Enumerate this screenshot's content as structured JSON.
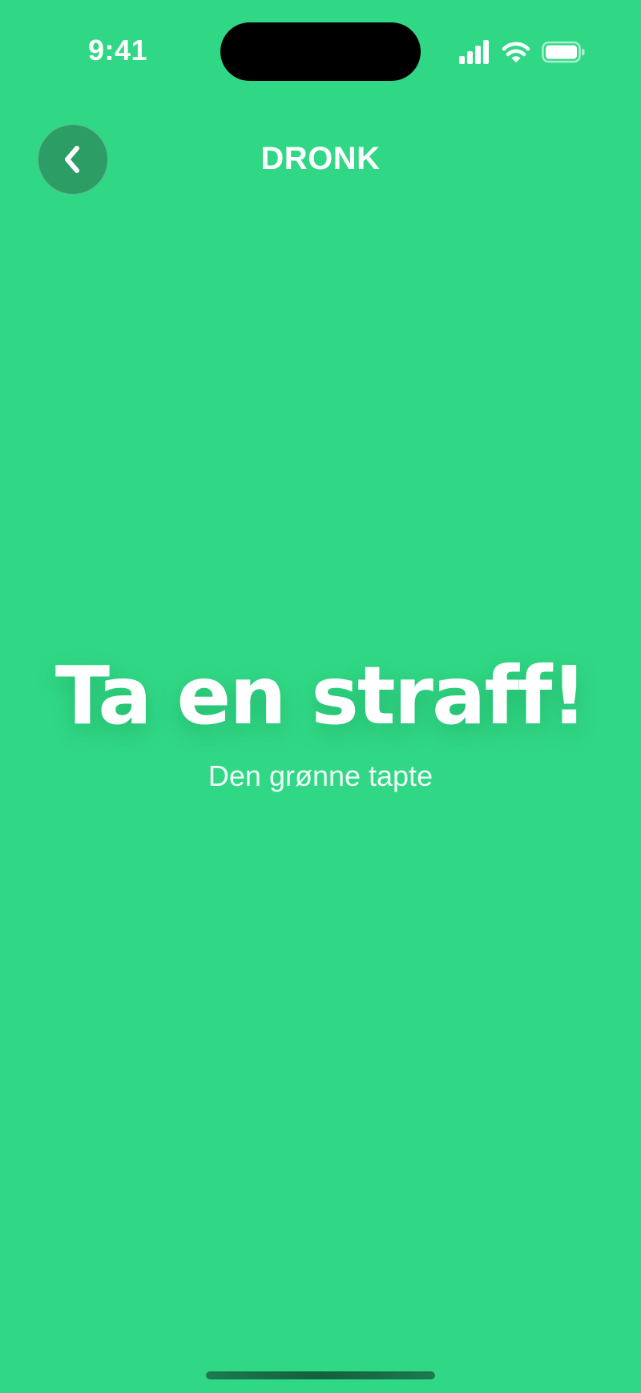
{
  "status_bar": {
    "time": "9:41",
    "icons": [
      "cellular-signal-icon",
      "wifi-icon",
      "battery-icon"
    ]
  },
  "nav": {
    "back_icon": "chevron-left-icon",
    "title": "DRONK"
  },
  "main": {
    "headline": "Ta en straff!",
    "subtitle": "Den grønne tapte"
  },
  "colors": {
    "background": "#30d885",
    "text": "#ffffff",
    "back_button_bg": "#2f8a5c"
  }
}
